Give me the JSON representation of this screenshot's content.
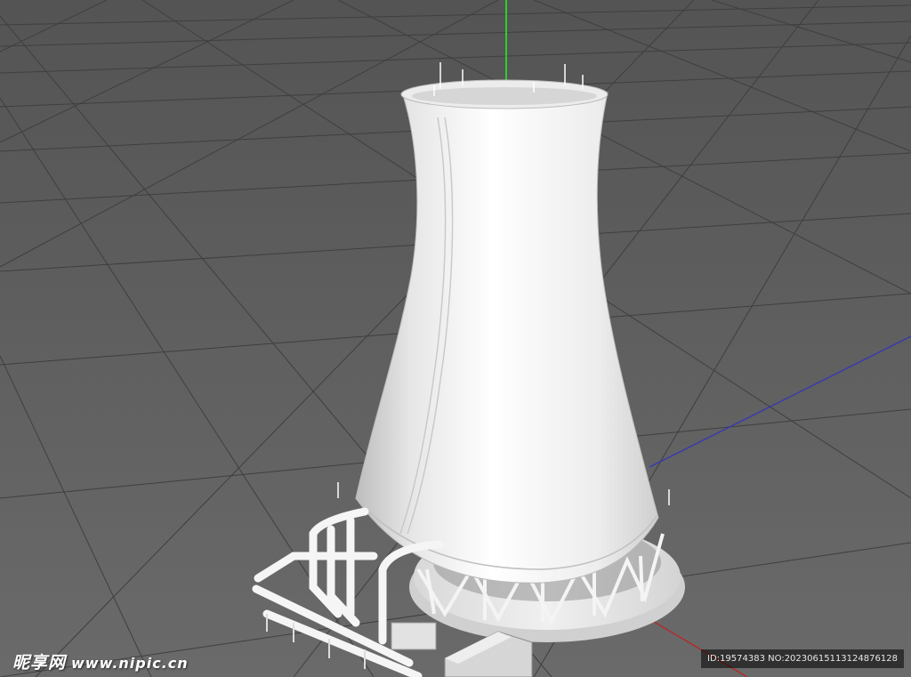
{
  "viewport": {
    "background_color": "#5d5d5d",
    "grid_color": "#404040",
    "model_color": "#f2f2f2",
    "axis_colors": {
      "y": "#2bd02b",
      "x": "#c02020",
      "z": "#3030c0"
    }
  },
  "watermark": {
    "site_name": "昵享网",
    "site_url": "www.nipic.cn",
    "image_id": "ID:19574383 NO:20230615113124876128"
  }
}
